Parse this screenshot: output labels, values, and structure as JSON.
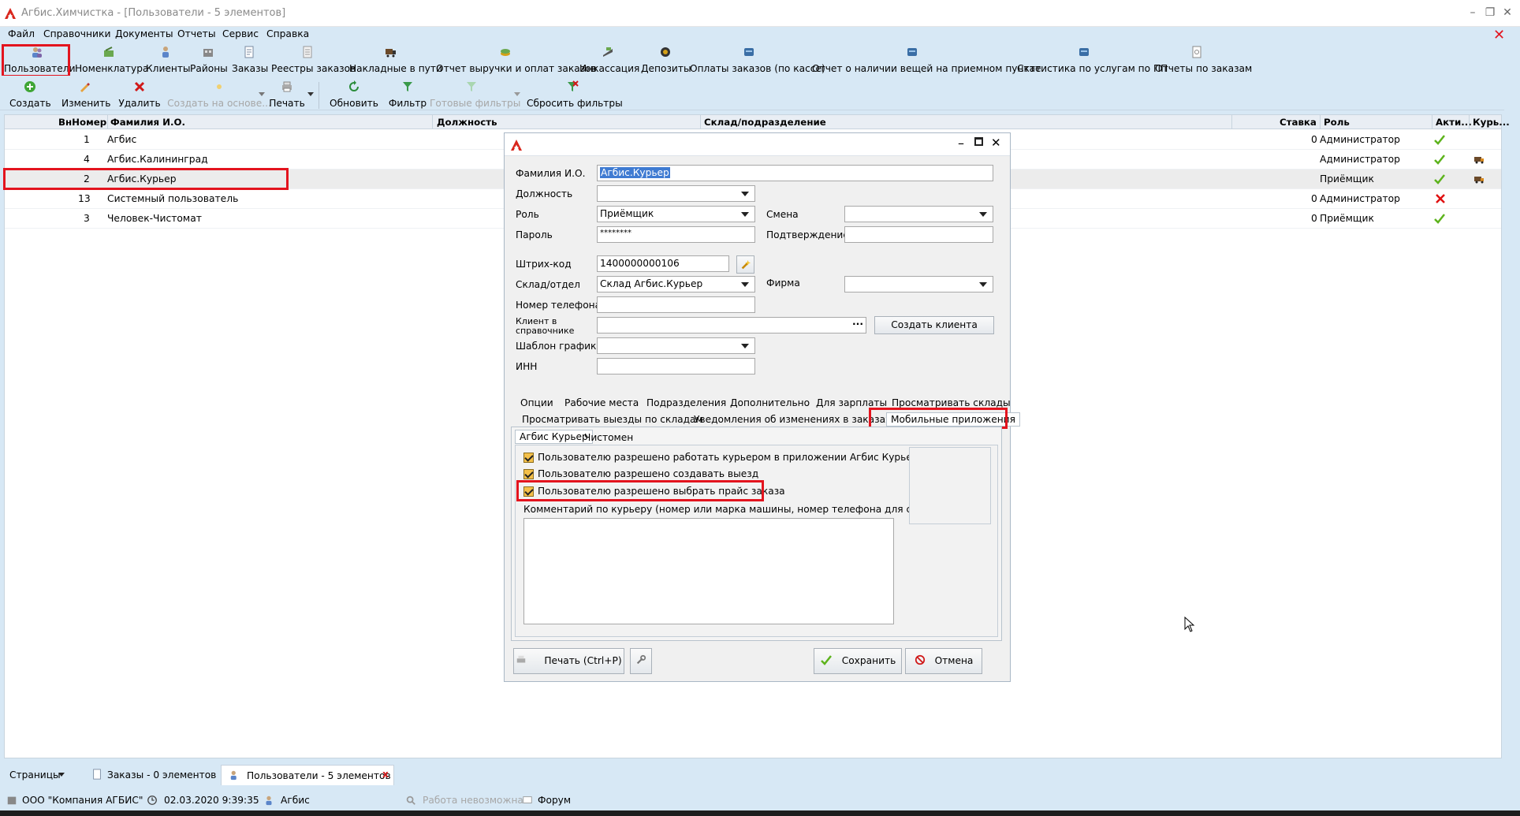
{
  "window": {
    "title": "Агбис.Химчистка - [Пользователи - 5 элементов]"
  },
  "menu": [
    "Файл",
    "Справочники",
    "Документы",
    "Отчеты",
    "Сервис",
    "Справка"
  ],
  "toolbar_top": [
    "Пользователи",
    "Номенклатура",
    "Клиенты",
    "Районы",
    "Заказы",
    "Реестры заказов",
    "Накладные в пути",
    "Отчет выручки и оплат заказов",
    "Инкассация",
    "Депозиты",
    "Оплаты заказов (по кассе)",
    "Отчет о наличии вещей на приемном пункте",
    "Статистика по услугам по ПП",
    "Отчеты по заказам"
  ],
  "toolbar_actions": {
    "create": "Создать",
    "edit": "Изменить",
    "delete": "Удалить",
    "create_based": "Создать на основе...",
    "print": "Печать",
    "refresh": "Обновить",
    "filter": "Фильтр",
    "ready_filters": "Готовые фильтры",
    "reset_filters": "Сбросить фильтры"
  },
  "grid": {
    "headers": {
      "num": "ВнНомер",
      "name": "Фамилия И.О.",
      "position": "Должность",
      "warehouse": "Склад/подразделение",
      "rate": "Ставка",
      "role": "Роль",
      "active": "Акти...",
      "courier": "Курь..."
    },
    "rows": [
      {
        "num": "1",
        "name": "Агбис",
        "rate": "0",
        "role": "Администратор",
        "active": "yes",
        "courier": ""
      },
      {
        "num": "4",
        "name": "Агбис.Калининград",
        "rate": "",
        "role": "Администратор",
        "active": "yes",
        "courier": "yes"
      },
      {
        "num": "2",
        "name": "Агбис.Курьер",
        "rate": "",
        "role": "Приёмщик",
        "active": "yes",
        "courier": "yes"
      },
      {
        "num": "13",
        "name": "Системный пользователь",
        "rate": "0",
        "role": "Администратор",
        "active": "no",
        "courier": ""
      },
      {
        "num": "3",
        "name": "Человек-Чистомат",
        "rate": "0",
        "role": "Приёмщик",
        "active": "yes",
        "courier": ""
      }
    ]
  },
  "dialog": {
    "fields": {
      "fio_label": "Фамилия И.О.",
      "fio_value": "Агбис.Курьер",
      "position_label": "Должность",
      "position_value": "",
      "role_label": "Роль",
      "role_value": "Приёмщик",
      "shift_label": "Смена",
      "shift_value": "",
      "password_label": "Пароль",
      "password_value": "********",
      "confirm_label": "Подтверждение",
      "confirm_value": "",
      "barcode_label": "Штрих-код",
      "barcode_value": "1400000000106",
      "warehouse_label": "Склад/отдел",
      "warehouse_value": "Склад Агбис.Курьер",
      "firm_label": "Фирма",
      "firm_value": "",
      "phone_label": "Номер телефона",
      "phone_value": "",
      "client_label_1": "Клиент в",
      "client_label_2": "справочнике",
      "client_value": "",
      "client_more": "...",
      "create_client": "Создать клиента",
      "schedule_label": "Шаблон графика",
      "schedule_value": "",
      "inn_label": "ИНН",
      "inn_value": ""
    },
    "tabs_row1": [
      "Опции",
      "Рабочие места",
      "Подразделения",
      "Дополнительно",
      "Для зарплаты",
      "Просматривать склады"
    ],
    "tabs_row2": [
      "Просматривать выезды по складам",
      "Уведомления об изменениях в заказах",
      "Мобильные приложения"
    ],
    "subtabs": [
      "Агбис Курьер",
      "Чистомен"
    ],
    "checkboxes": [
      "Пользователю разрешено работать курьером в приложении Агбис Курьер",
      "Пользователю разрешено создавать выезд",
      "Пользователю разрешено выбрать прайс заказа"
    ],
    "comment_label": "Комментарий по курьеру (номер или марка машины, номер телефона для связи )",
    "comment_value": "",
    "buttons": {
      "print": "Печать (Ctrl+P)",
      "save": "Сохранить",
      "cancel": "Отмена"
    }
  },
  "bottom_tabs": {
    "pages": "Страницы",
    "orders": "Заказы - 0 элементов",
    "users": "Пользователи - 5 элементов",
    "close": "x"
  },
  "status": {
    "company": "ООО \"Компания АГБИС\"",
    "datetime": "02.03.2020 9:39:35",
    "user": "Агбис",
    "work": "Работа невозможна",
    "forum": "Форум"
  },
  "colors": {
    "highlight": "#e3141e",
    "background": "#d7e8f5",
    "check": "#5db31c",
    "cross": "#e01010"
  }
}
